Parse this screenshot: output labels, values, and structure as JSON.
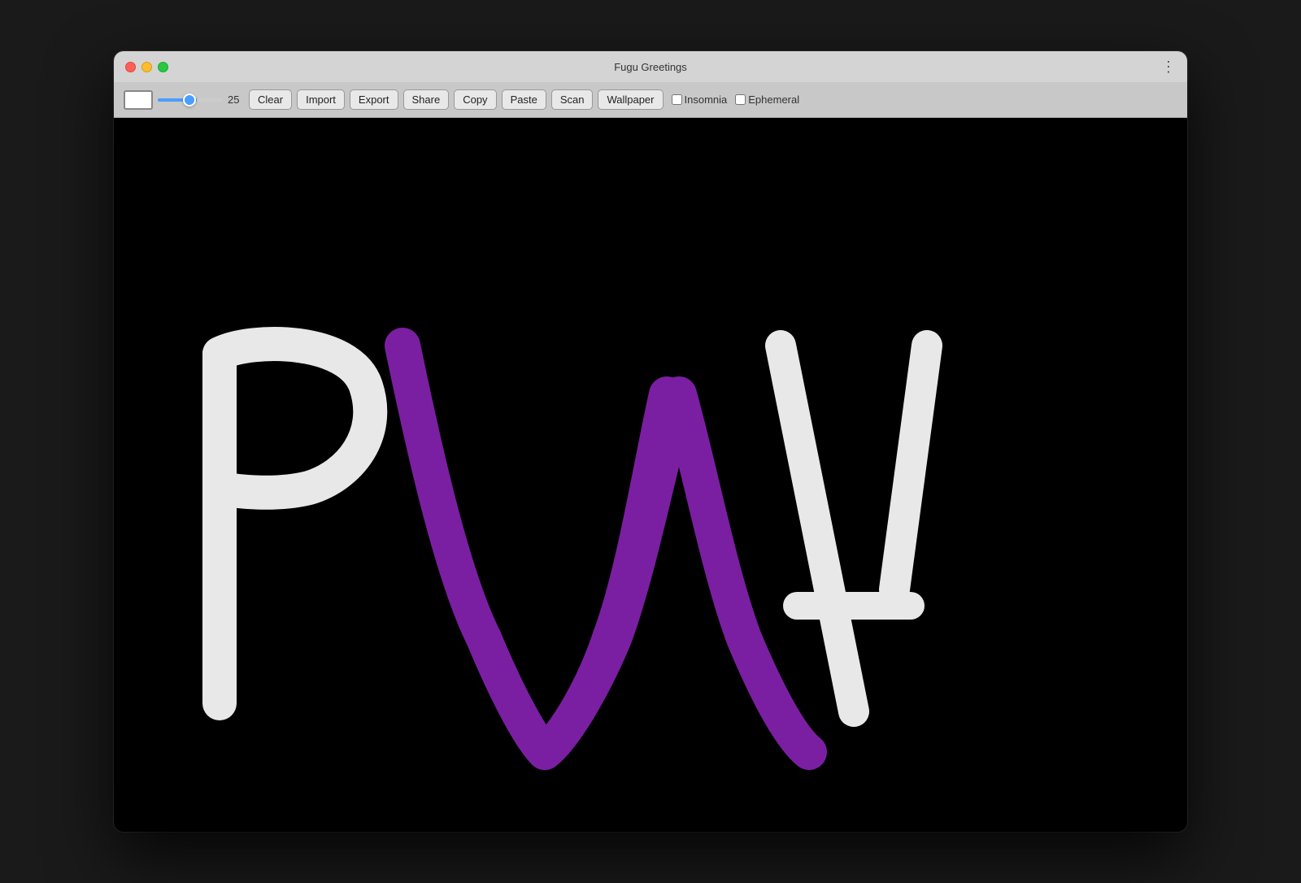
{
  "window": {
    "title": "Fugu Greetings"
  },
  "toolbar": {
    "brush_size": "25",
    "buttons": [
      {
        "id": "clear",
        "label": "Clear"
      },
      {
        "id": "import",
        "label": "Import"
      },
      {
        "id": "export",
        "label": "Export"
      },
      {
        "id": "share",
        "label": "Share"
      },
      {
        "id": "copy",
        "label": "Copy"
      },
      {
        "id": "paste",
        "label": "Paste"
      },
      {
        "id": "scan",
        "label": "Scan"
      },
      {
        "id": "wallpaper",
        "label": "Wallpaper"
      }
    ],
    "checkboxes": [
      {
        "id": "insomnia",
        "label": "Insomnia",
        "checked": false
      },
      {
        "id": "ephemeral",
        "label": "Ephemeral",
        "checked": false
      }
    ]
  },
  "colors": {
    "window_bg": "#1e1e1e",
    "titlebar_bg": "#d4d4d4",
    "toolbar_bg": "#c8c8c8",
    "canvas_bg": "#000000",
    "stroke_white": "#f0f0f0",
    "stroke_purple": "#7B1FA2",
    "accent_blue": "#4a9eff"
  }
}
